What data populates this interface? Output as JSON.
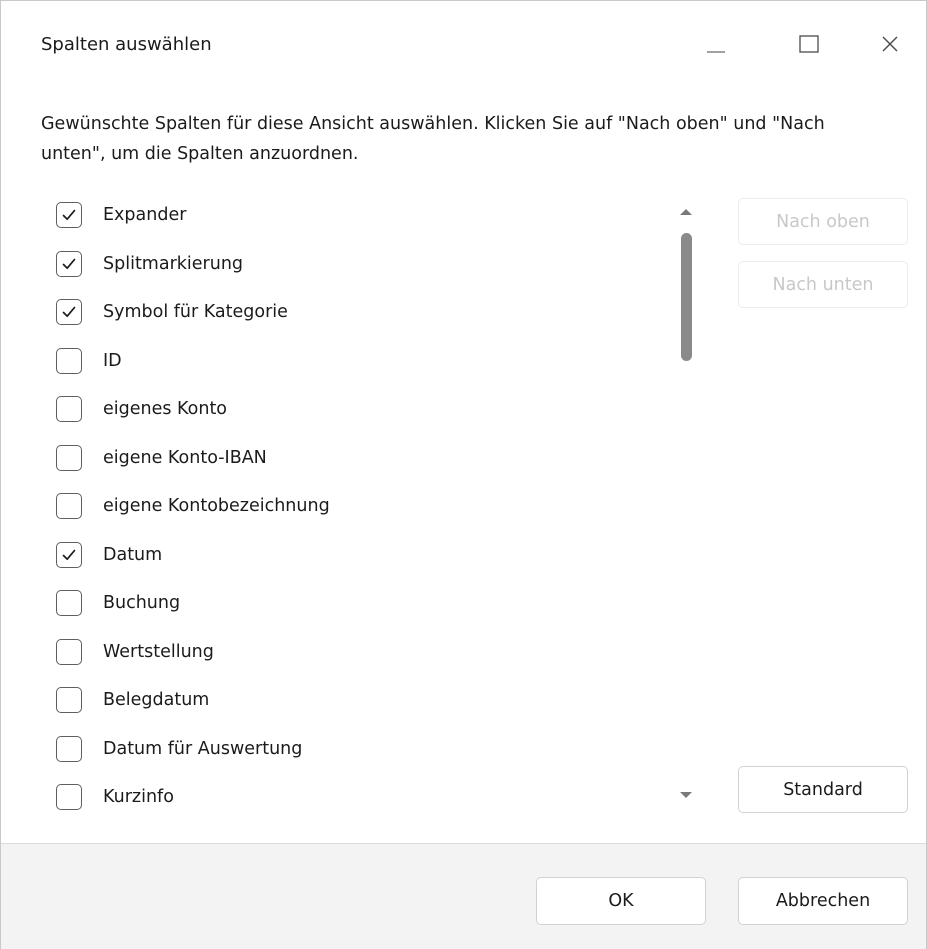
{
  "dialog": {
    "title": "Spalten auswählen",
    "instruction": "Gewünschte Spalten für diese Ansicht auswählen. Klicken Sie auf \"Nach oben\" und \"Nach unten\", um die Spalten anzuordnen."
  },
  "columns": [
    {
      "label": "Expander",
      "checked": true
    },
    {
      "label": "Splitmarkierung",
      "checked": true
    },
    {
      "label": "Symbol für Kategorie",
      "checked": true
    },
    {
      "label": "ID",
      "checked": false
    },
    {
      "label": "eigenes Konto",
      "checked": false
    },
    {
      "label": "eigene Konto-IBAN",
      "checked": false
    },
    {
      "label": "eigene Kontobezeichnung",
      "checked": false
    },
    {
      "label": "Datum",
      "checked": true
    },
    {
      "label": "Buchung",
      "checked": false
    },
    {
      "label": "Wertstellung",
      "checked": false
    },
    {
      "label": "Belegdatum",
      "checked": false
    },
    {
      "label": "Datum für Auswertung",
      "checked": false
    },
    {
      "label": "Kurzinfo",
      "checked": false
    }
  ],
  "buttons": {
    "move_up": "Nach oben",
    "move_down": "Nach unten",
    "default": "Standard",
    "ok": "OK",
    "cancel": "Abbrechen"
  },
  "icons": {
    "minimize": "minimize-icon",
    "maximize": "maximize-icon",
    "close": "close-icon",
    "check": "checkmark-icon"
  }
}
